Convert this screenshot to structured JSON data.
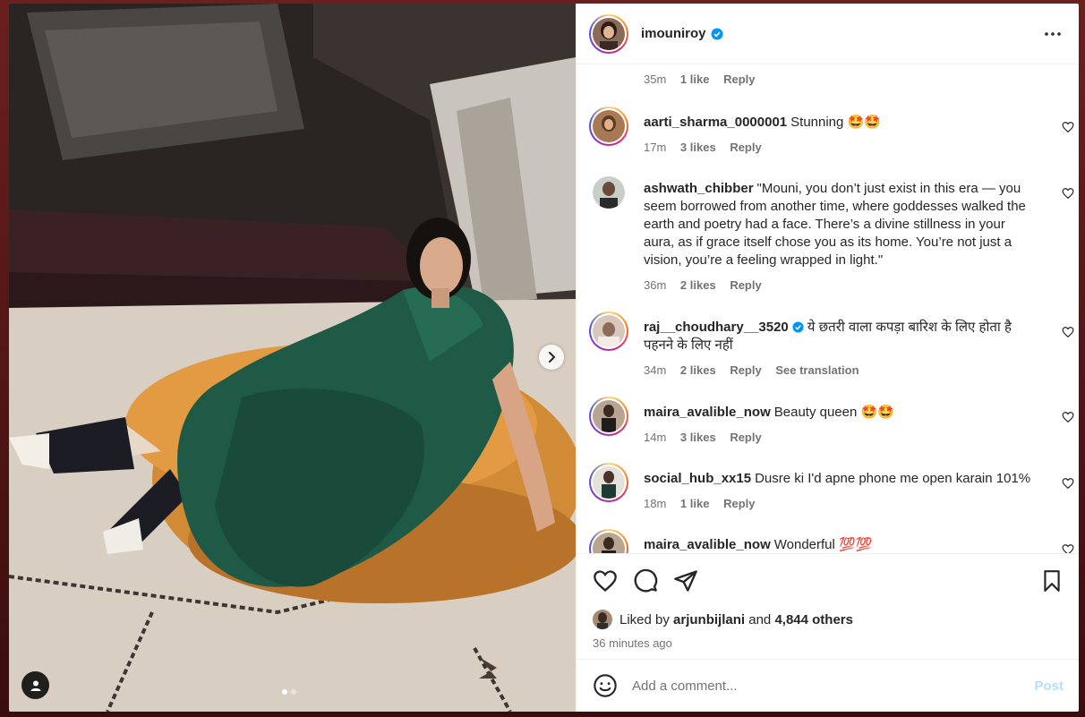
{
  "post": {
    "username": "imouniroy",
    "verified": true,
    "image_alt": "Woman in green leather dress reclining on an orange bean bag",
    "carousel": {
      "total": 2,
      "active": 1
    }
  },
  "caption_meta": {
    "time": "35m",
    "likes": "1 like",
    "reply": "Reply"
  },
  "comments": [
    {
      "user": "aarti_sharma_0000001",
      "verified": false,
      "text": "Stunning 🤩🤩",
      "time": "17m",
      "likes": "3 likes",
      "reply": "Reply"
    },
    {
      "user": "ashwath_chibber",
      "verified": false,
      "text": "\"Mouni, you don’t just exist in this era — you seem borrowed from another time, where goddesses walked the earth and poetry had a face. There’s a divine stillness in your aura, as if grace itself chose you as its home. You’re not just a vision, you’re a feeling wrapped in light.\"",
      "time": "36m",
      "likes": "2 likes",
      "reply": "Reply"
    },
    {
      "user": "raj__choudhary__3520",
      "verified": true,
      "text": "ये छतरी वाला कपड़ा बारिश के लिए होता है पहनने के लिए नहीं",
      "time": "34m",
      "likes": "2 likes",
      "reply": "Reply",
      "translate": "See translation"
    },
    {
      "user": "maira_avalible_now",
      "verified": false,
      "text": "Beauty queen 🤩🤩",
      "time": "14m",
      "likes": "3 likes",
      "reply": "Reply"
    },
    {
      "user": "social_hub_xx15",
      "verified": false,
      "text": "Dusre ki I'd apne phone me open karain 101%",
      "time": "18m",
      "likes": "1 like",
      "reply": "Reply"
    },
    {
      "user": "maira_avalible_now",
      "verified": false,
      "text": "Wonderful 💯💯",
      "time": "",
      "likes": "",
      "reply": ""
    }
  ],
  "actions": {
    "liked_by_prefix": "Liked by",
    "liked_by_user": "arjunbijlani",
    "liked_by_and": "and",
    "others": "4,844 others",
    "time_ago": "36 minutes ago"
  },
  "composer": {
    "placeholder": "Add a comment...",
    "post_label": "Post"
  },
  "icons": {
    "more": "more-icon",
    "heart": "heart-icon",
    "comment": "comment-icon",
    "share": "share-icon",
    "save": "bookmark-icon",
    "emoji": "emoji-icon",
    "verified": "verified-badge-icon",
    "next": "chevron-right-icon",
    "tag": "user-tag-icon"
  },
  "colors": {
    "verified": "#0095f6",
    "post_disabled": "#b2dffc",
    "meta": "#737373"
  }
}
